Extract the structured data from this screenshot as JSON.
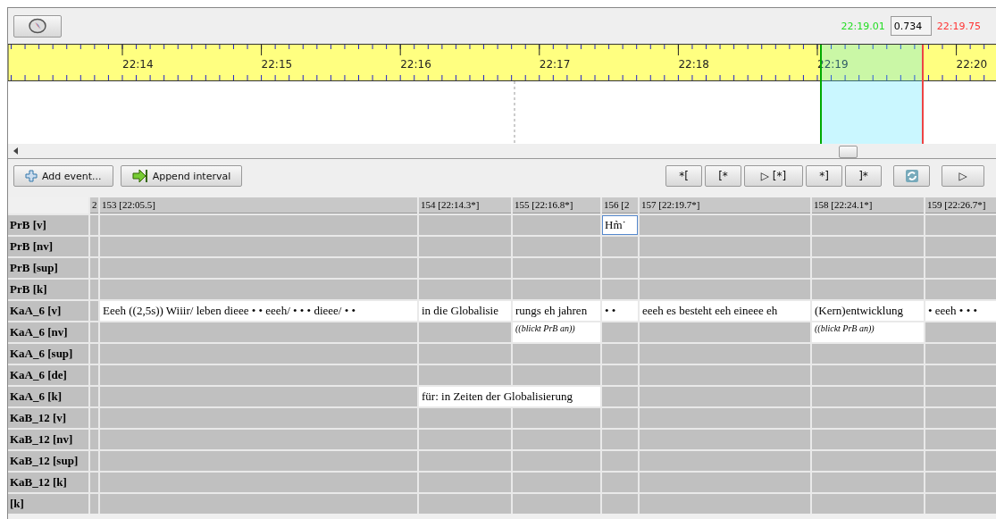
{
  "toolbar": {
    "selection_start": "22:19.01",
    "selection_length": "0.734",
    "selection_end": "22:19.75"
  },
  "timeline": {
    "ticks": [
      "22:14",
      "22:15",
      "22:16",
      "22:17",
      "22:18",
      "22:19",
      "22:20"
    ]
  },
  "buttons": [
    {
      "label": "Add event...",
      "kind": "add"
    },
    {
      "label": "Append interval",
      "kind": "append"
    }
  ],
  "play_buttons": [
    {
      "label": "*[",
      "kind": "text"
    },
    {
      "label": "[*",
      "kind": "text"
    },
    {
      "label": "▷ [*]",
      "kind": "text"
    },
    {
      "label": "*]",
      "kind": "text"
    },
    {
      "label": "]*",
      "kind": "text"
    },
    {
      "kind": "refresh"
    },
    {
      "label": "▷",
      "kind": "text"
    }
  ],
  "columns": [
    "2",
    "153 [22:05.5]",
    "154 [22:14.3*]",
    "155 [22:16.8*]",
    "156 [2",
    "157 [22:19.7*]",
    "158 [22:24.1*]",
    "159 [22:26.7*]"
  ],
  "tiers": [
    {
      "label": "PrB [v]",
      "cells": [
        {
          "kind": "empty"
        },
        {
          "kind": "empty"
        },
        {
          "kind": "empty"
        },
        {
          "kind": "empty"
        },
        {
          "kind": "event",
          "text": "Hm̀˙",
          "italic": false,
          "selected": true
        },
        {
          "kind": "empty"
        },
        {
          "kind": "empty"
        },
        {
          "kind": "empty"
        }
      ]
    },
    {
      "label": "PrB [nv]"
    },
    {
      "label": "PrB [sup]"
    },
    {
      "label": "PrB [k]"
    },
    {
      "label": "KaA_6 [v]",
      "cells": [
        {
          "kind": "empty"
        },
        {
          "kind": "event",
          "text": "Eeeh ((2,5s)) Wiiir/ leben dieee • • eeeh/ • • • dieee/ • •",
          "italic": false,
          "selected": false
        },
        {
          "kind": "event",
          "text": "in die Globalisie",
          "italic": false,
          "selected": false
        },
        {
          "kind": "event",
          "text": "rungs eh jahren",
          "italic": false,
          "selected": false
        },
        {
          "kind": "event",
          "text": "• •",
          "italic": false,
          "selected": false
        },
        {
          "kind": "event",
          "text": "eeeh es besteht eeh eineee eh",
          "italic": false,
          "selected": false
        },
        {
          "kind": "event",
          "text": "(Kern)entwicklung",
          "italic": false,
          "selected": false
        },
        {
          "kind": "event",
          "text": "• eeeh • • •",
          "italic": false,
          "selected": false
        }
      ]
    },
    {
      "label": "KaA_6 [nv]",
      "cells": [
        {
          "kind": "empty"
        },
        {
          "kind": "empty"
        },
        {
          "kind": "empty"
        },
        {
          "kind": "event",
          "text": "((blickt PrB an))",
          "italic": true,
          "selected": false
        },
        {
          "kind": "empty"
        },
        {
          "kind": "empty"
        },
        {
          "kind": "event",
          "text": "((blickt PrB an))",
          "italic": true,
          "selected": false
        },
        {
          "kind": "empty"
        }
      ]
    },
    {
      "label": "KaA_6 [sup]"
    },
    {
      "label": "KaA_6 [de]"
    },
    {
      "label": "KaA_6 [k]",
      "cells": [
        {
          "kind": "empty"
        },
        {
          "kind": "empty"
        },
        {
          "kind": "merged_event",
          "text": "für: in Zeiten der Globalisierung",
          "italic": false,
          "selected": false
        },
        {
          "kind": "empty"
        },
        {
          "kind": "empty"
        },
        {
          "kind": "empty"
        },
        {
          "kind": "empty"
        }
      ]
    },
    {
      "label": "KaB_12 [v]"
    },
    {
      "label": "KaB_12 [nv]"
    },
    {
      "label": "KaB_12 [sup]"
    },
    {
      "label": "KaB_12 [k]"
    },
    {
      "label": "[k]"
    }
  ]
}
